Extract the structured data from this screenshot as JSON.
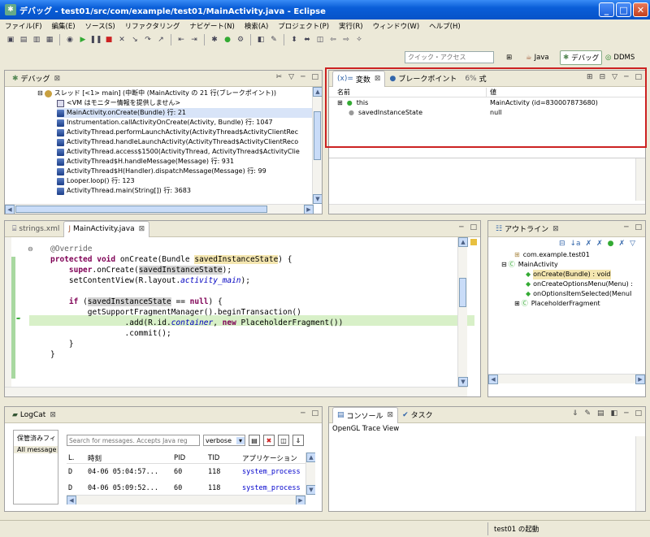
{
  "window": {
    "title": "デバッグ - test01/src/com/example/test01/MainActivity.java - Eclipse"
  },
  "menu": [
    "ファイル(F)",
    "編集(E)",
    "ソース(S)",
    "リファクタリング",
    "ナビゲート(N)",
    "検索(A)",
    "プロジェクト(P)",
    "実行(R)",
    "ウィンドウ(W)",
    "ヘルプ(H)"
  ],
  "quick_access": {
    "placeholder": "クイック・アクセス"
  },
  "perspectives": [
    {
      "label": "Java"
    },
    {
      "label": "デバッグ"
    },
    {
      "label": "DDMS"
    }
  ],
  "debug_view": {
    "tab": "デバッグ",
    "thread": "スレッド [<1> main] (中断中 (MainActivity の 21 行(ブレークポイント))",
    "frames": [
      "<VM はモニター情報を提供しません>",
      "MainActivity.onCreate(Bundle) 行: 21",
      "Instrumentation.callActivityOnCreate(Activity, Bundle) 行: 1047",
      "ActivityThread.performLaunchActivity(ActivityThread$ActivityClientRec",
      "ActivityThread.handleLaunchActivity(ActivityThread$ActivityClientReco",
      "ActivityThread.access$1500(ActivityThread, ActivityThread$ActivityClie",
      "ActivityThread$H.handleMessage(Message) 行: 931",
      "ActivityThread$H(Handler).dispatchMessage(Message) 行: 99",
      "Looper.loop() 行: 123",
      "ActivityThread.main(String[]) 行: 3683"
    ]
  },
  "variables_view": {
    "tabs": [
      "変数",
      "ブレークポイント",
      "式"
    ],
    "columns": [
      "名前",
      "値"
    ],
    "rows": [
      {
        "name": "this",
        "value": "MainActivity  (id=830007873680)"
      },
      {
        "name": "savedInstanceState",
        "value": "null"
      }
    ],
    "highlight_color": "#cc2222"
  },
  "editor": {
    "tabs": [
      "strings.xml",
      "MainActivity.java"
    ],
    "code": {
      "l1": "@Override",
      "l2a": "protected",
      "l2b": "void",
      "l2c": " onCreate(Bundle ",
      "l2d": "savedInstanceState",
      "l2e": ") {",
      "l3a": "super",
      "l3b": ".onCreate(",
      "l3c": "savedInstanceState",
      "l3d": ");",
      "l4a": "setContentView(R.layout.",
      "l4b": "activity_main",
      "l4c": ");",
      "l6a": "if",
      "l6b": " (",
      "l6c": "savedInstanceState",
      "l6d": " == ",
      "l6e": "null",
      "l6f": ") {",
      "l7": "getSupportFragmentManager().beginTransaction()",
      "l8a": ".add(R.id.",
      "l8b": "container",
      "l8c": ", ",
      "l8d": "new",
      "l8e": " PlaceholderFragment())",
      "l9": ".commit();",
      "l10": "}",
      "l11": "}"
    }
  },
  "outline_view": {
    "tab": "アウトライン",
    "items": [
      "com.example.test01",
      "MainActivity",
      "onCreate(Bundle) : void",
      "onCreateOptionsMenu(Menu) :",
      "onOptionsItemSelected(MenuI",
      "PlaceholderFragment"
    ]
  },
  "logcat_view": {
    "tab": "LogCat",
    "saved_filters": "保管済みフィ",
    "all_messages": "All message",
    "search_placeholder": "Search for messages. Accepts Java reg",
    "level": "verbose",
    "columns": [
      "L.",
      "時刻",
      "PID",
      "TID",
      "アプリケーション"
    ],
    "rows": [
      {
        "level": "D",
        "time": "04-06 05:04:57...",
        "pid": "60",
        "tid": "118",
        "app": "system_process"
      },
      {
        "level": "D",
        "time": "04-06 05:09:52...",
        "pid": "60",
        "tid": "118",
        "app": "system_process"
      }
    ]
  },
  "console_view": {
    "tabs": [
      "コンソール",
      "タスク"
    ],
    "text": "OpenGL Trace View"
  },
  "status": {
    "text": "test01 の起動"
  }
}
